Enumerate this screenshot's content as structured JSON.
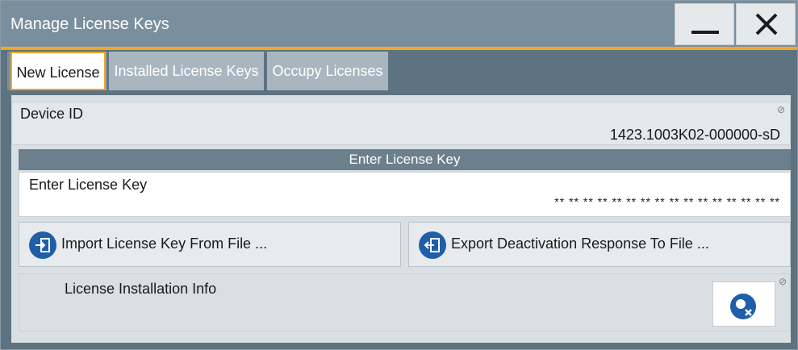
{
  "window": {
    "title": "Manage License Keys"
  },
  "tabs": [
    {
      "label": "New License",
      "active": true
    },
    {
      "label": "Installed License Keys",
      "active": false
    },
    {
      "label": "Occupy Licenses",
      "active": false
    }
  ],
  "device": {
    "label": "Device ID",
    "value": "1423.1003K02-000000-sD"
  },
  "license_section": {
    "header": "Enter License Key",
    "field_label": "Enter License Key",
    "field_value": "** ** ** ** ** ** ** ** ** ** ** ** ** ** ** **"
  },
  "buttons": {
    "import_label": "Import License Key From File ...",
    "export_label": "Export Deactivation Response To File ..."
  },
  "info": {
    "label": "License Installation Info"
  },
  "colors": {
    "accent": "#f5a623",
    "titlebar": "#7a8f9e",
    "button_blue": "#1f5ea8",
    "tab_bg": "#a9b6bf"
  },
  "icons": {
    "minimize": "minimize-icon",
    "close": "close-icon",
    "import": "import-icon",
    "export": "export-icon",
    "clear": "clear-info-icon",
    "readonly": "readonly-icon"
  }
}
